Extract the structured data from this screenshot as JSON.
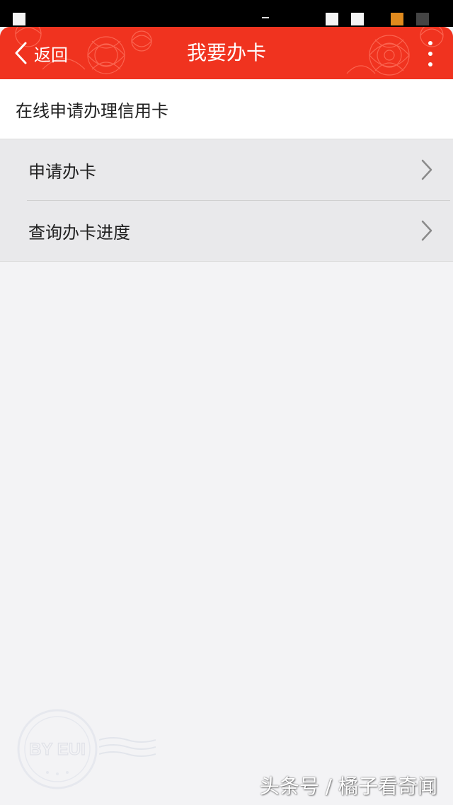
{
  "status_bar": {
    "icons": [
      "notification-icon",
      "signal-icon",
      "wifi-icon",
      "battery-icon",
      "time-icon"
    ]
  },
  "nav": {
    "back_label": "返回",
    "title": "我要办卡",
    "back_icon": "chevron-left-icon",
    "more_icon": "more-vertical-icon",
    "background_color": "#f0331f"
  },
  "section": {
    "title": "在线申请办理信用卡"
  },
  "menu": {
    "items": [
      {
        "label": "申请办卡",
        "icon": "chevron-right-icon"
      },
      {
        "label": "查询办卡进度",
        "icon": "chevron-right-icon"
      }
    ]
  },
  "watermark": {
    "badge_text": "BY EUI",
    "source": "头条号 / 橘子看奇闻"
  }
}
